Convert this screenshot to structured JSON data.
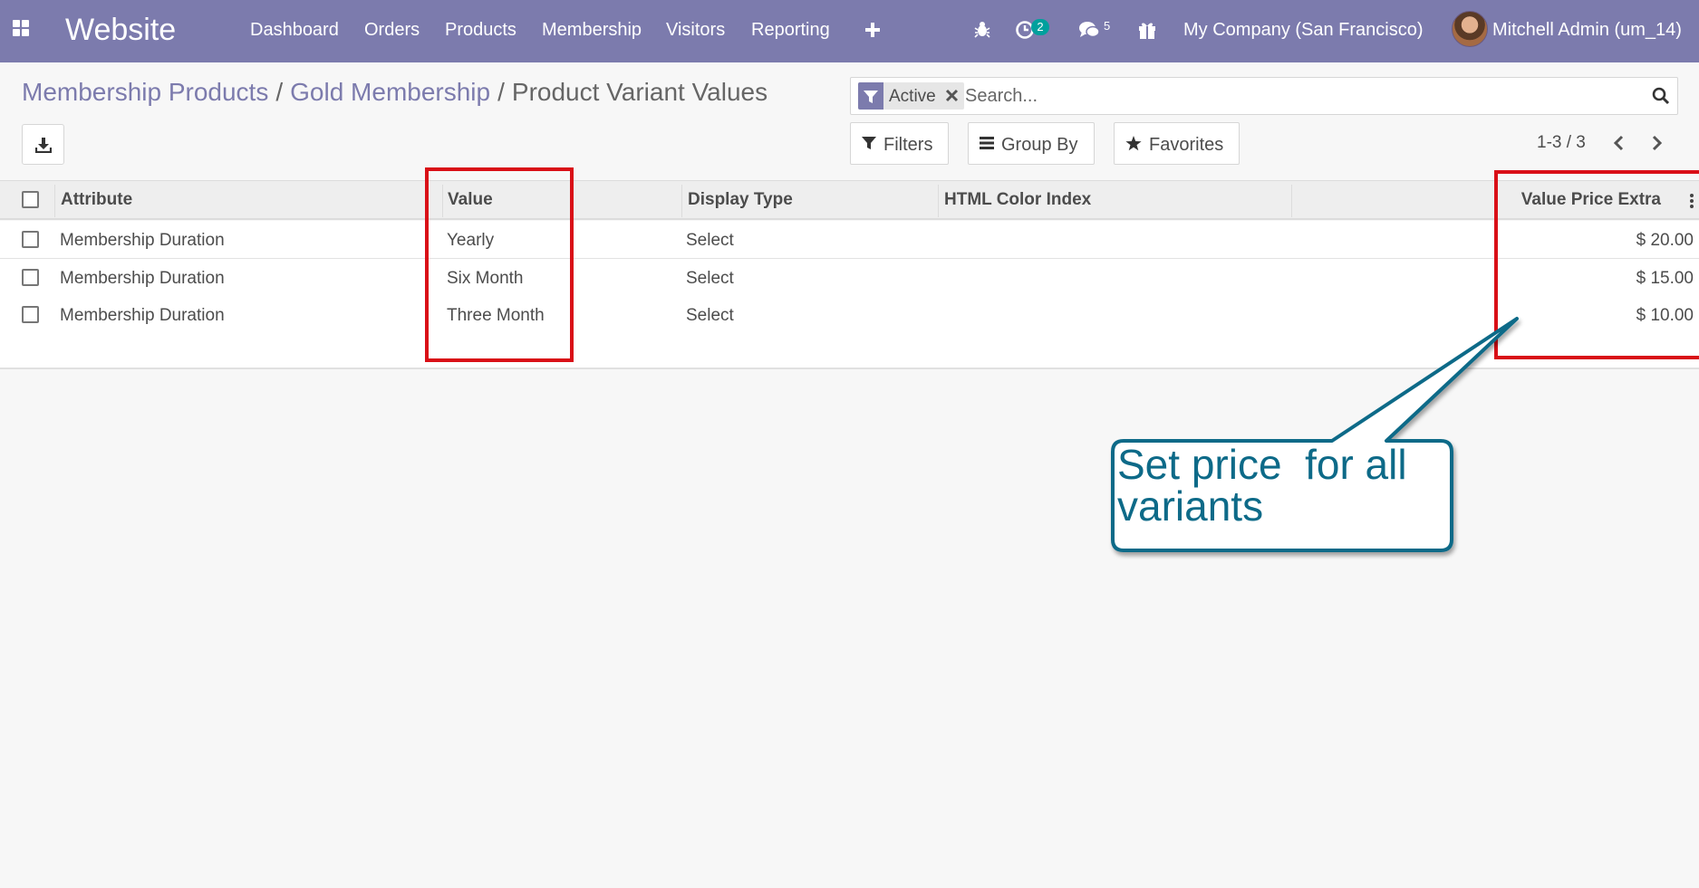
{
  "navbar": {
    "app_name": "Website",
    "menu": [
      "Dashboard",
      "Orders",
      "Products",
      "Membership",
      "Visitors",
      "Reporting"
    ],
    "activity_count": "2",
    "message_count": "5",
    "company": "My Company (San Francisco)",
    "user": "Mitchell Admin (um_14)",
    "accent": "#7c7bad"
  },
  "breadcrumb": {
    "level1": "Membership Products",
    "level2": "Gold Membership",
    "current": "Product Variant Values"
  },
  "search": {
    "facet": "Active",
    "placeholder": "Search..."
  },
  "toolbar": {
    "filters": "Filters",
    "group_by": "Group By",
    "favorites": "Favorites",
    "pager": "1-3 / 3"
  },
  "table": {
    "columns": {
      "attribute": "Attribute",
      "value": "Value",
      "display_type": "Display Type",
      "html_color": "HTML Color Index",
      "price_extra": "Value Price Extra"
    },
    "rows": [
      {
        "attribute": "Membership Duration",
        "value": "Yearly",
        "display_type": "Select",
        "price_extra": "$ 20.00"
      },
      {
        "attribute": "Membership Duration",
        "value": "Six Month",
        "display_type": "Select",
        "price_extra": "$ 15.00"
      },
      {
        "attribute": "Membership Duration",
        "value": "Three Month",
        "display_type": "Select",
        "price_extra": "$ 10.00"
      }
    ]
  },
  "annotation": {
    "callout_line1": "Set price  for all",
    "callout_line2": "variants",
    "highlight_color": "#d90f17",
    "callout_color": "#0d6a88"
  }
}
